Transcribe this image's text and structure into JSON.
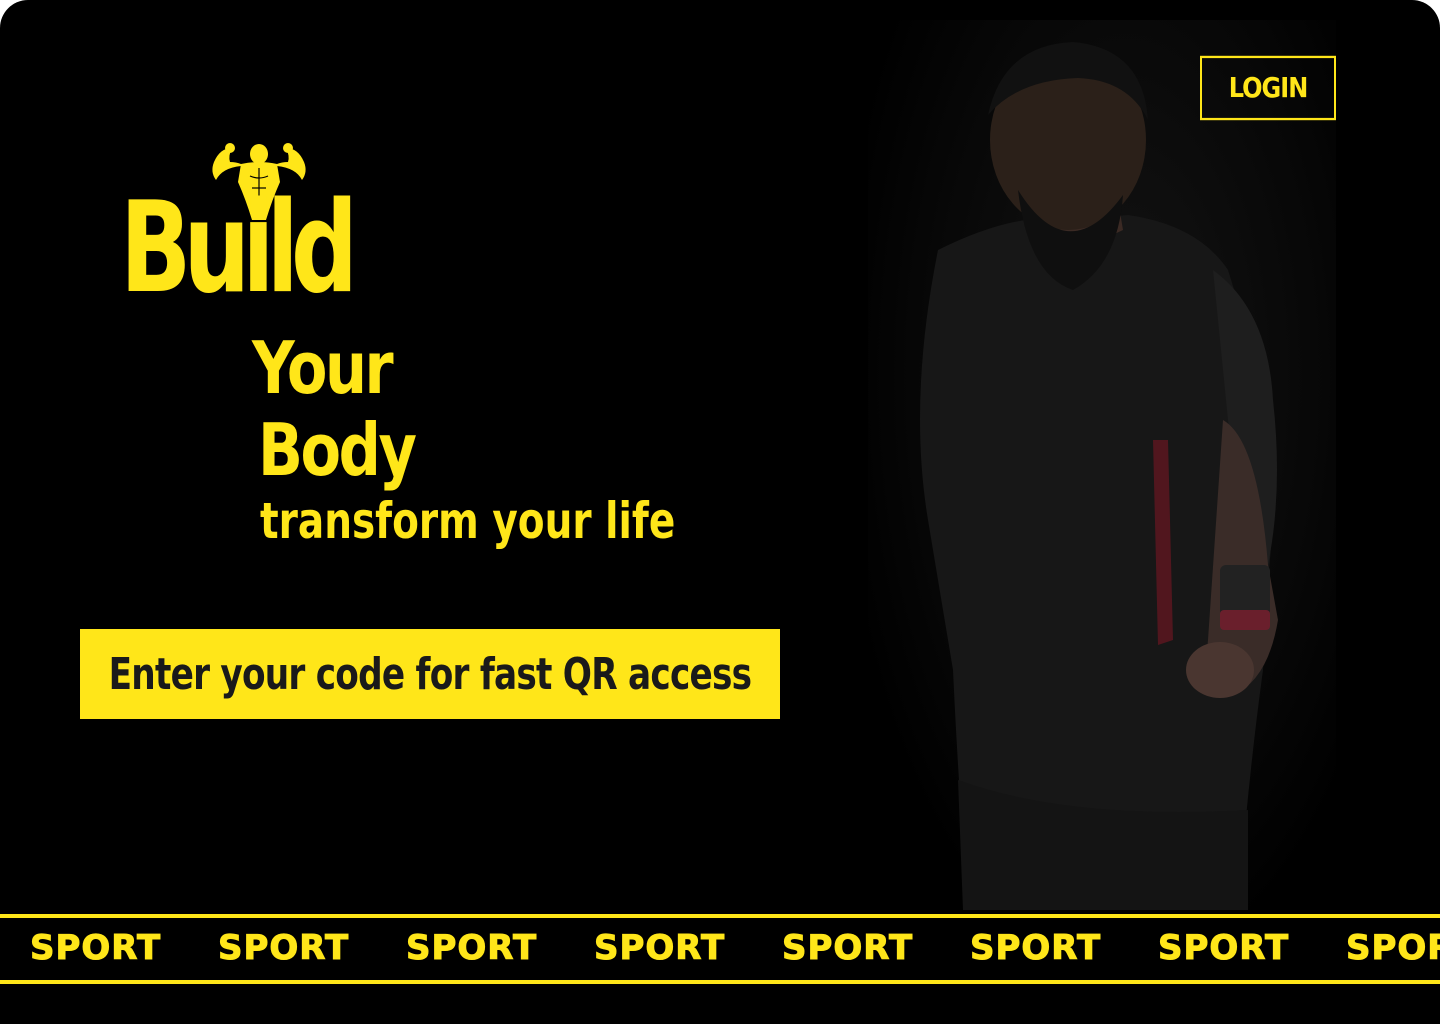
{
  "header": {
    "login_label": "LOGIN"
  },
  "hero": {
    "logo_icon": "bodybuilder-flex-icon",
    "headline_line1": "Build",
    "headline_line2": "Your",
    "headline_line3": "Body",
    "tagline": "transform your life",
    "cta_label": "Enter your code for fast QR access",
    "photo_icon": "athlete-photo"
  },
  "band": {
    "words": [
      "SPORT",
      "SPORT",
      "SPORT",
      "SPORT",
      "SPORT",
      "SPORT",
      "SPORT",
      "SPORT"
    ]
  },
  "colors": {
    "accent": "#ffe619",
    "background": "#000000",
    "cta_text": "#1a1a1a"
  }
}
